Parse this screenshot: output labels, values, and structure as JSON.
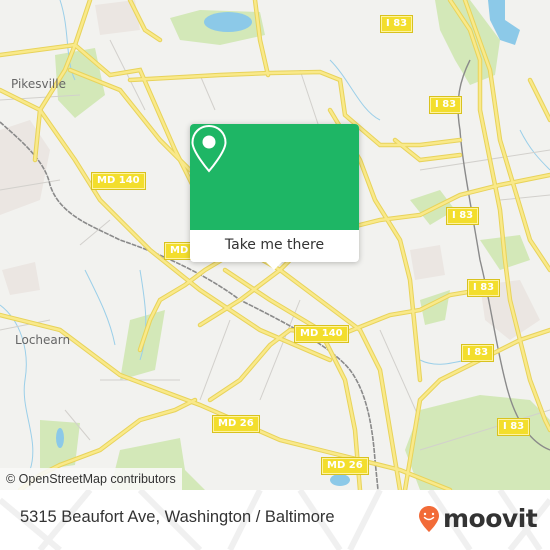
{
  "map": {
    "place_labels": [
      "Pikesville",
      "Lochearn"
    ],
    "road_shields": [
      "MD 140",
      "MD",
      "MD 140",
      "MD 26",
      "MD 26",
      "I 83",
      "I 83",
      "I 83",
      "I 83",
      "I 83",
      "I 83"
    ],
    "attribution": "© OpenStreetMap contributors",
    "colors": {
      "background": "#f2f2ef",
      "road": "#f5e36b",
      "park": "#cfe6ae",
      "water": "#8cc9e8",
      "rail": "#8a8a8a"
    }
  },
  "popup": {
    "icon": "location-pin-icon",
    "button_label": "Take me there",
    "color": "#1eb665"
  },
  "footer": {
    "address": "5315 Beaufort Ave, Washington / Baltimore",
    "logo_text": "moovit",
    "logo_icon": "moovit-pin-icon",
    "logo_color": "#f26b38"
  }
}
